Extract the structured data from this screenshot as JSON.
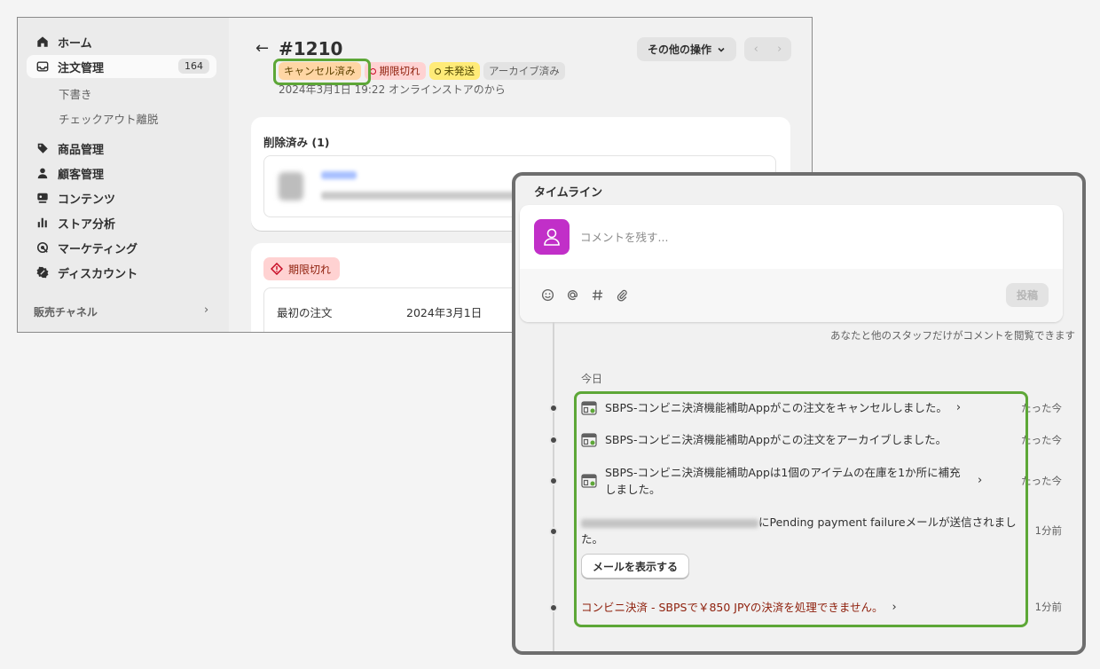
{
  "sidebar": {
    "items": [
      {
        "label": "ホーム",
        "icon": "home-icon"
      },
      {
        "label": "注文管理",
        "icon": "inbox-icon",
        "count": "164"
      },
      {
        "label": "商品管理",
        "icon": "tag-icon"
      },
      {
        "label": "顧客管理",
        "icon": "person-icon"
      },
      {
        "label": "コンテンツ",
        "icon": "content-icon"
      },
      {
        "label": "ストア分析",
        "icon": "chart-icon"
      },
      {
        "label": "マーケティング",
        "icon": "target-icon"
      },
      {
        "label": "ディスカウント",
        "icon": "discount-icon"
      }
    ],
    "subitems": [
      "下書き",
      "チェックアウト離脱"
    ],
    "section_label": "販売チャネル"
  },
  "order": {
    "title": "#1210",
    "badges": {
      "cancelled": "キャンセル済み",
      "expired": "期限切れ",
      "unsent": "未発送",
      "archived": "アーカイブ済み"
    },
    "meta": "2024年3月1日 19:22 オンラインストアのから",
    "more_actions": "その他の操作",
    "deleted_title": "削除済み (1)",
    "expired_badge": "期限切れ",
    "first_order_label": "最初の注文",
    "first_order_value": "2024年3月1日"
  },
  "timeline": {
    "title": "タイムライン",
    "comment_placeholder": "コメントを残す...",
    "post_label": "投稿",
    "visibility_note": "あなたと他のスタッフだけがコメントを閲覧できます",
    "date_label": "今日",
    "events": [
      {
        "text": "SBPS-コンビニ決済機能補助Appがこの注文をキャンセルしました。",
        "time": "たった今"
      },
      {
        "text": "SBPS-コンビニ決済機能補助Appがこの注文をアーカイブしました。",
        "time": "たった今"
      },
      {
        "text": "SBPS-コンビニ決済機能補助Appは1個のアイテムの在庫を1か所に補充しました。",
        "time": "たった今"
      },
      {
        "text": "にPending payment failureメールが送信されました。",
        "time": "1分前"
      },
      {
        "text": "コンビニ決済 - SBPSで￥850 JPYの決済を処理できません。",
        "time": "1分前"
      }
    ],
    "show_email_label": "メールを表示する"
  },
  "colors": {
    "highlight": "#5da737",
    "avatar": "#c12fc8"
  }
}
